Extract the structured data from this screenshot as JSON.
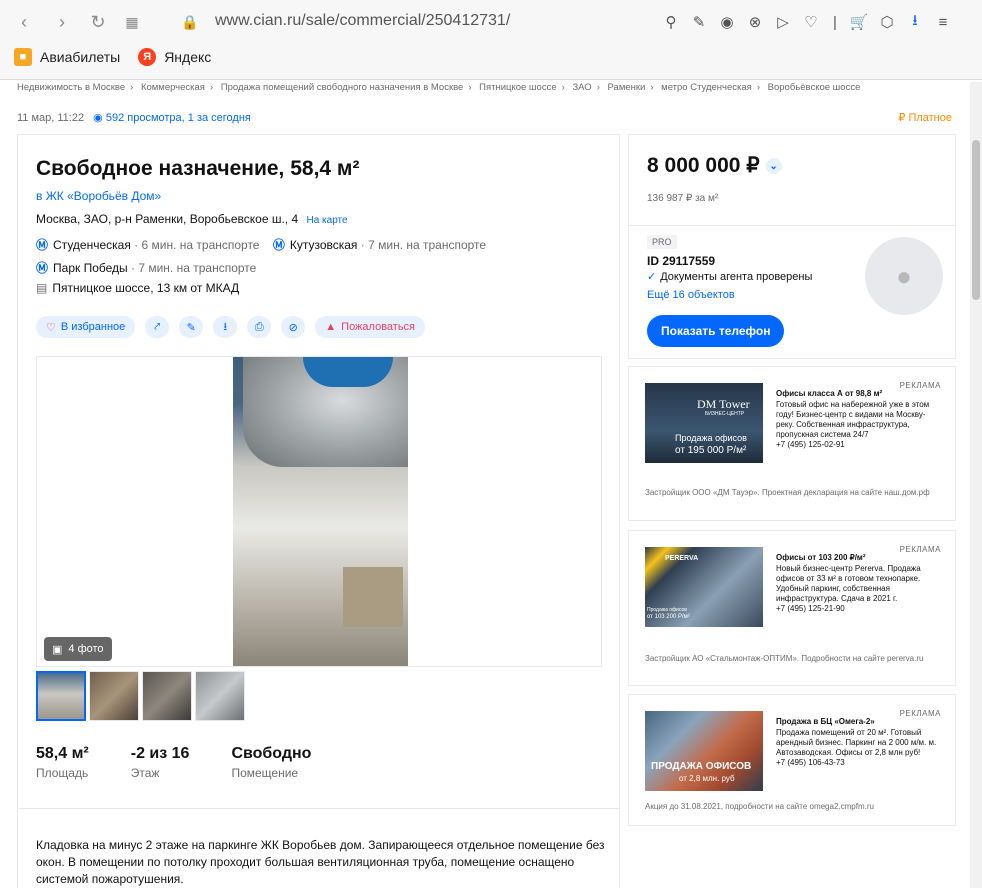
{
  "browser": {
    "url": "www.cian.ru/sale/commercial/250412731/",
    "bookmarks": [
      {
        "label": "Авиабилеты"
      },
      {
        "label": "Яндекс"
      }
    ]
  },
  "breadcrumbs": [
    "Недвижимость в Москве",
    "Коммерческая",
    "Продажа помещений свободного назначения в Москве",
    "Пятницкое шоссе",
    "ЗАО",
    "Раменки",
    "метро Студенческая",
    "Воробьёвское шоссе"
  ],
  "meta": {
    "date": "11 мар, 11:22",
    "views": "592 просмотра, 1 за сегодня",
    "paid": "Платное"
  },
  "listing": {
    "title": "Свободное назначение, 58,4 м²",
    "complex": "в ЖК «Воробьёв Дом»",
    "address": "Москва, ЗАО, р-н Раменки, Воробьевское ш., 4",
    "map_link": "На карте",
    "metro": [
      {
        "name": "Студенческая",
        "time": "· 6 мин. на транспорте"
      },
      {
        "name": "Кутузовская",
        "time": "· 7 мин. на транспорте"
      },
      {
        "name": "Парк Победы",
        "time": "· 7 мин. на транспорте"
      }
    ],
    "highway": "Пятницкое шоссе,",
    "highway_dist": "13 км от МКАД",
    "favorite_label": "В избранное",
    "complain_label": "Пожаловаться",
    "photo_count": "4 фото",
    "facts": [
      {
        "value": "58,4 м²",
        "label": "Площадь"
      },
      {
        "value": "-2 из 16",
        "label": "Этаж"
      },
      {
        "value": "Свободно",
        "label": "Помещение"
      }
    ],
    "description": "Кладовка на минус 2 этаже на паркинге ЖК Воробьев дом. Запирающееся отдельное помещение без окон. В помещении по потолку проходит большая вентиляционная труба, помещение оснащено системой пожаротушения."
  },
  "price": {
    "value": "8 000 000 ₽",
    "per_m2": "136 987 ₽ за м²",
    "pro": "PRO",
    "agent_id": "ID 29117559",
    "verified": "Документы агента проверены",
    "more": "Ещё 16 объектов",
    "phone_btn": "Показать телефон"
  },
  "ads": [
    {
      "label": "РЕКЛАМА",
      "img_title": "DM Tower",
      "img_sub": "БИЗНЕС-ЦЕНТР",
      "img_line1": "Продажа офисов",
      "img_line2": "от 195 000 Р/м²",
      "heading": "Офисы класса А от 98,8 м²",
      "body": "Готовый офис на набережной уже в этом году! Бизнес-центр с видами на Москву-реку. Собственная инфраструктура, пропускная система 24/7",
      "phone": "+7 (495) 125-02-91",
      "footer": "Застройщик ООО «ДМ Тауэр». Проектная декларация на сайте наш.дом.рф"
    },
    {
      "label": "РЕКЛАМА",
      "img_title": "PERERVA",
      "img_line1": "Продажа офисов",
      "img_line2": "от 103 200 Р/м²",
      "heading": "Офисы от 103 200 ₽/м²",
      "body": "Новый бизнес-центр Pererva. Продажа офисов от 33 м² в готовом технопарке. Удобный паркинг, собственная инфраструктура. Сдача в 2021 г.",
      "phone": "+7 (495) 125-21-90",
      "footer": "Застройщик АО «Стальмонтаж-ОПТИМ». Подробности на сайте pererva.ru"
    },
    {
      "label": "РЕКЛАМА",
      "img_line1": "ПРОДАЖА ОФИСОВ",
      "img_line2": "от 2,8 млн. руб",
      "heading": "Продажа в БЦ «Омега-2»",
      "body": "Продажа помещений от 20 м². Готовый арендный бизнес. Паркинг на 2 000 м/м. м. Автозаводская. Офисы от 2,8 млн руб!",
      "phone": "+7 (495) 106-43-73",
      "footer": "Акция до 31.08.2021, подробности на сайте omega2.cmpfm.ru"
    }
  ]
}
